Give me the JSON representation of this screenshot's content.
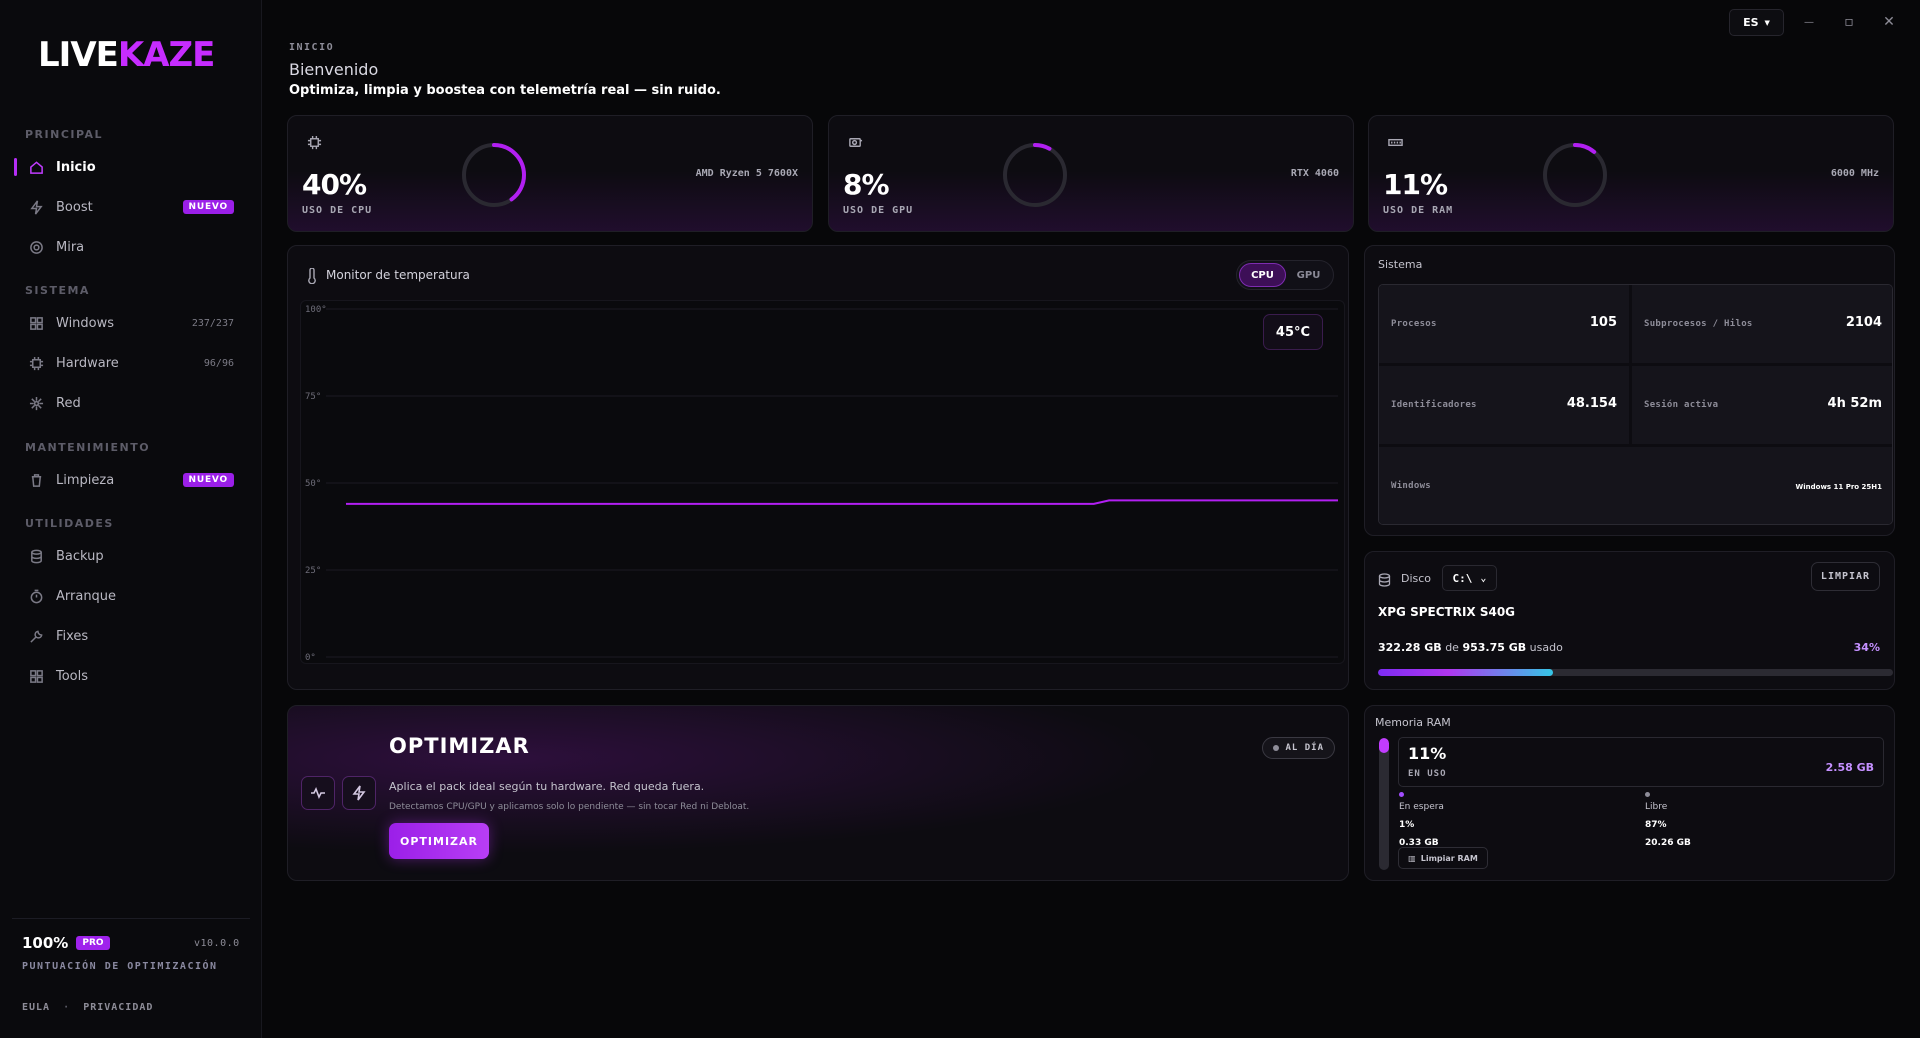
{
  "brand": {
    "part1": "LIVE",
    "part2": "KAZE",
    "accent": "#c62cff"
  },
  "sidebar": {
    "sections": [
      {
        "label": "PRINCIPAL",
        "items": [
          {
            "label": "Inicio",
            "icon": "home-icon",
            "active": true
          },
          {
            "label": "Boost",
            "icon": "bolt-icon",
            "badge": "NUEVO"
          },
          {
            "label": "Mira",
            "icon": "crosshair-icon"
          }
        ]
      },
      {
        "label": "SISTEMA",
        "items": [
          {
            "label": "Windows",
            "icon": "grid-icon",
            "count": "237/237"
          },
          {
            "label": "Hardware",
            "icon": "chip-icon",
            "count": "96/96"
          },
          {
            "label": "Red",
            "icon": "network-icon"
          }
        ]
      },
      {
        "label": "MANTENIMIENTO",
        "items": [
          {
            "label": "Limpieza",
            "icon": "trash-icon",
            "badge": "NUEVO"
          }
        ]
      },
      {
        "label": "UTILIDADES",
        "items": [
          {
            "label": "Backup",
            "icon": "database-icon"
          },
          {
            "label": "Arranque",
            "icon": "timer-icon"
          },
          {
            "label": "Fixes",
            "icon": "wrench-icon"
          },
          {
            "label": "Tools",
            "icon": "apps-icon"
          }
        ]
      }
    ],
    "score": "100%",
    "score_badge": "PRO",
    "version": "v10.0.0",
    "score_label": "PUNTUACIÓN DE OPTIMIZACIÓN",
    "legal": {
      "eula": "EULA",
      "sep": "·",
      "privacy": "PRIVACIDAD"
    }
  },
  "titlebar": {
    "lang": "ES",
    "minimize": "—",
    "maximize": "▫",
    "close": "✕"
  },
  "header": {
    "crumb": "INICIO",
    "title": "Bienvenido",
    "subtitle": "Optimiza, limpia y boostea con telemetría real — sin ruido."
  },
  "stats": [
    {
      "value": "40%",
      "label": "USO DE CPU",
      "model": "AMD Ryzen 5 7600X",
      "percent": 40,
      "icon": "cpu-icon"
    },
    {
      "value": "8%",
      "label": "USO DE GPU",
      "model": "RTX 4060",
      "percent": 8,
      "icon": "gpu-icon"
    },
    {
      "value": "11%",
      "label": "USO DE RAM",
      "model": "6000 MHz",
      "percent": 11,
      "icon": "ram-icon"
    }
  ],
  "temperature": {
    "title": "Monitor de temperatura",
    "tabs": [
      "CPU",
      "GPU"
    ],
    "active_tab": "CPU",
    "current": "45°C"
  },
  "chart_data": {
    "type": "line",
    "title": "",
    "ylim": [
      0,
      100
    ],
    "yticks": [
      "100°",
      "75°",
      "50°",
      "25°",
      "0°"
    ],
    "grid": true,
    "series": [
      {
        "values": [
          44,
          44,
          44,
          44,
          44,
          44,
          44,
          44,
          44,
          44,
          44,
          44,
          44,
          44,
          44,
          44,
          44,
          44,
          44,
          44,
          44,
          44,
          44,
          44,
          44,
          44,
          44,
          44,
          44,
          44,
          44,
          44,
          44,
          44,
          44,
          44,
          44,
          44,
          44,
          44,
          44,
          44,
          44,
          44,
          44,
          44,
          44,
          44,
          44,
          44,
          45,
          45,
          45,
          45,
          45,
          45,
          45,
          45,
          45,
          45,
          45,
          45,
          45,
          45,
          45,
          45
        ]
      }
    ],
    "line_color": "#b21ff2"
  },
  "system": {
    "title": "Sistema",
    "cells": [
      {
        "key": "Procesos",
        "value": "105"
      },
      {
        "key": "Subprocesos / Hilos",
        "value": "2104"
      },
      {
        "key": "Identificadores",
        "value": "48.154"
      },
      {
        "key": "Sesión activa",
        "value": "4h 52m"
      },
      {
        "key": "Windows",
        "value": "Windows 11 Pro 25H1"
      }
    ]
  },
  "disk": {
    "label": "Disco",
    "drive": "C:\\",
    "clean_label": "LIMPIAR",
    "name": "XPG SPECTRIX S40G",
    "used": "322.28 GB",
    "of": "de",
    "total": "953.75 GB",
    "used_word": "usado",
    "percent_label": "34%",
    "percent": 34
  },
  "optimize": {
    "title": "OPTIMIZAR",
    "description": "Aplica el pack ideal según tu hardware. Red queda fuera.",
    "detail": "Detectamos CPU/GPU y aplicamos solo lo pendiente — sin tocar Red ni Debloat.",
    "button": "OPTIMIZAR",
    "status": "AL DÍA"
  },
  "ram": {
    "title": "Memoria RAM",
    "value": "11%",
    "label": "EN USO",
    "gb": "2.58 GB",
    "percent": 11,
    "standby": {
      "name": "En espera",
      "pct": "1%",
      "size": "0.33 GB",
      "color": "#a24dff"
    },
    "free": {
      "name": "Libre",
      "pct": "87%",
      "size": "20.26 GB",
      "color": "#8e8d99"
    },
    "button": "Limpiar RAM"
  }
}
